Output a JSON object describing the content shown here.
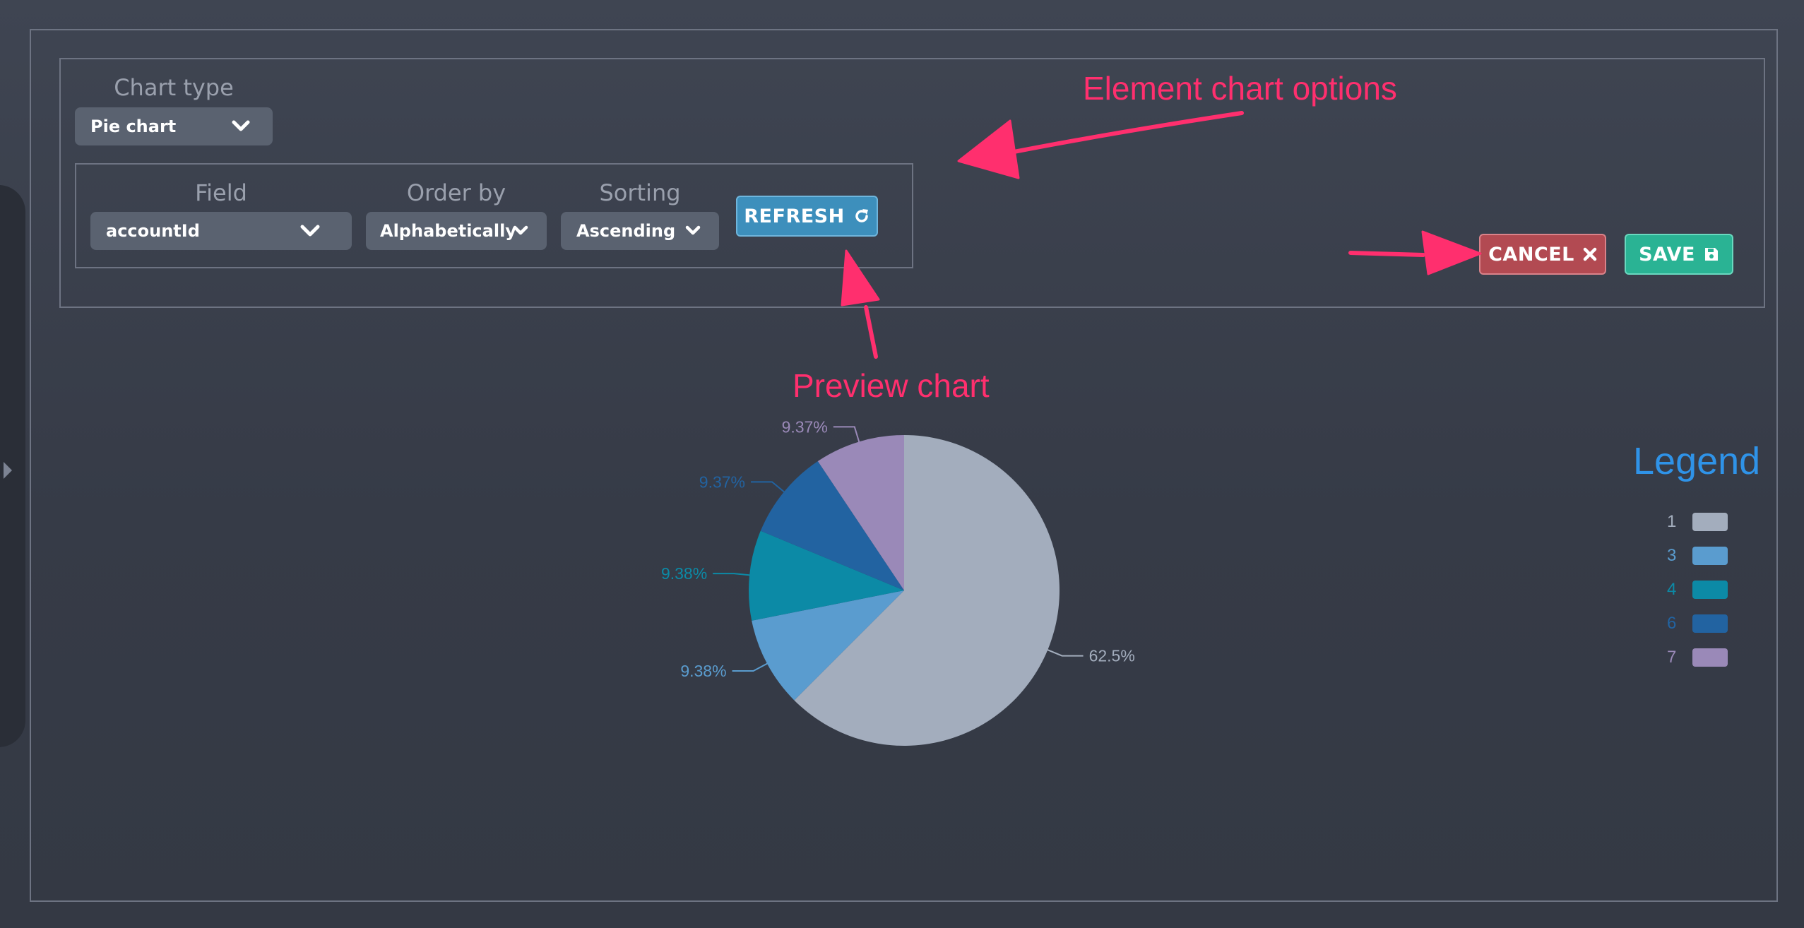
{
  "chart_type": {
    "label": "Chart type",
    "value": "Pie chart"
  },
  "query": {
    "field_label": "Field",
    "field_value": "accountId",
    "order_label": "Order by",
    "order_value": "Alphabetically",
    "sorting_label": "Sorting",
    "sorting_value": "Ascending",
    "refresh_label": "REFRESH"
  },
  "actions": {
    "cancel_label": "CANCEL",
    "save_label": "SAVE"
  },
  "annotations": {
    "element_options": "Element chart options",
    "preview": "Preview chart"
  },
  "icons": [
    "chevron-down-icon",
    "refresh-icon",
    "close-icon",
    "save-icon",
    "sidebar-toggle-icon"
  ],
  "colors": {
    "cancel": "#b24a52",
    "save": "#2ab394",
    "refresh": "#3d8fbc",
    "annotation": "#ff2f6e",
    "legend_title": "#2f93e8"
  },
  "legend": {
    "title": "Legend"
  },
  "chart_data": {
    "type": "pie",
    "slices": [
      {
        "label": "1",
        "value": 62.5,
        "value_label": "62.5%",
        "color": "#a3adbd"
      },
      {
        "label": "3",
        "value": 9.38,
        "value_label": "9.38%",
        "color": "#5a9ccf"
      },
      {
        "label": "4",
        "value": 9.38,
        "value_label": "9.38%",
        "color": "#0c8aa6"
      },
      {
        "label": "6",
        "value": 9.37,
        "value_label": "9.37%",
        "color": "#2263a1"
      },
      {
        "label": "7",
        "value": 9.37,
        "value_label": "9.37%",
        "color": "#9a89b8"
      }
    ]
  }
}
